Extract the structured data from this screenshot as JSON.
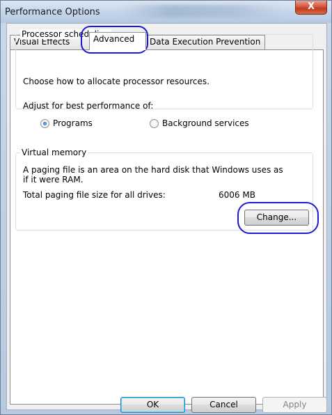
{
  "window": {
    "title": "Performance Options",
    "close_glyph": "X"
  },
  "tabs": [
    {
      "label": "Visual Effects"
    },
    {
      "label": "Advanced"
    },
    {
      "label": "Data Execution Prevention"
    }
  ],
  "processor_scheduling": {
    "legend": "Processor scheduling",
    "description": "Choose how to allocate processor resources.",
    "adjust_label": "Adjust for best performance of:",
    "options": [
      {
        "label": "Programs",
        "checked": true
      },
      {
        "label": "Background services",
        "checked": false
      }
    ]
  },
  "virtual_memory": {
    "legend": "Virtual memory",
    "description_line1": "A paging file is an area on the hard disk that Windows uses as",
    "description_line2": "if it were RAM.",
    "total_label": "Total paging file size for all drives:",
    "total_value": "6006 MB",
    "change_button": "Change..."
  },
  "footer": {
    "ok": "OK",
    "cancel": "Cancel",
    "apply": "Apply"
  },
  "colors": {
    "annotation": "#1a1ad8",
    "close_button": "#c23a1f"
  }
}
